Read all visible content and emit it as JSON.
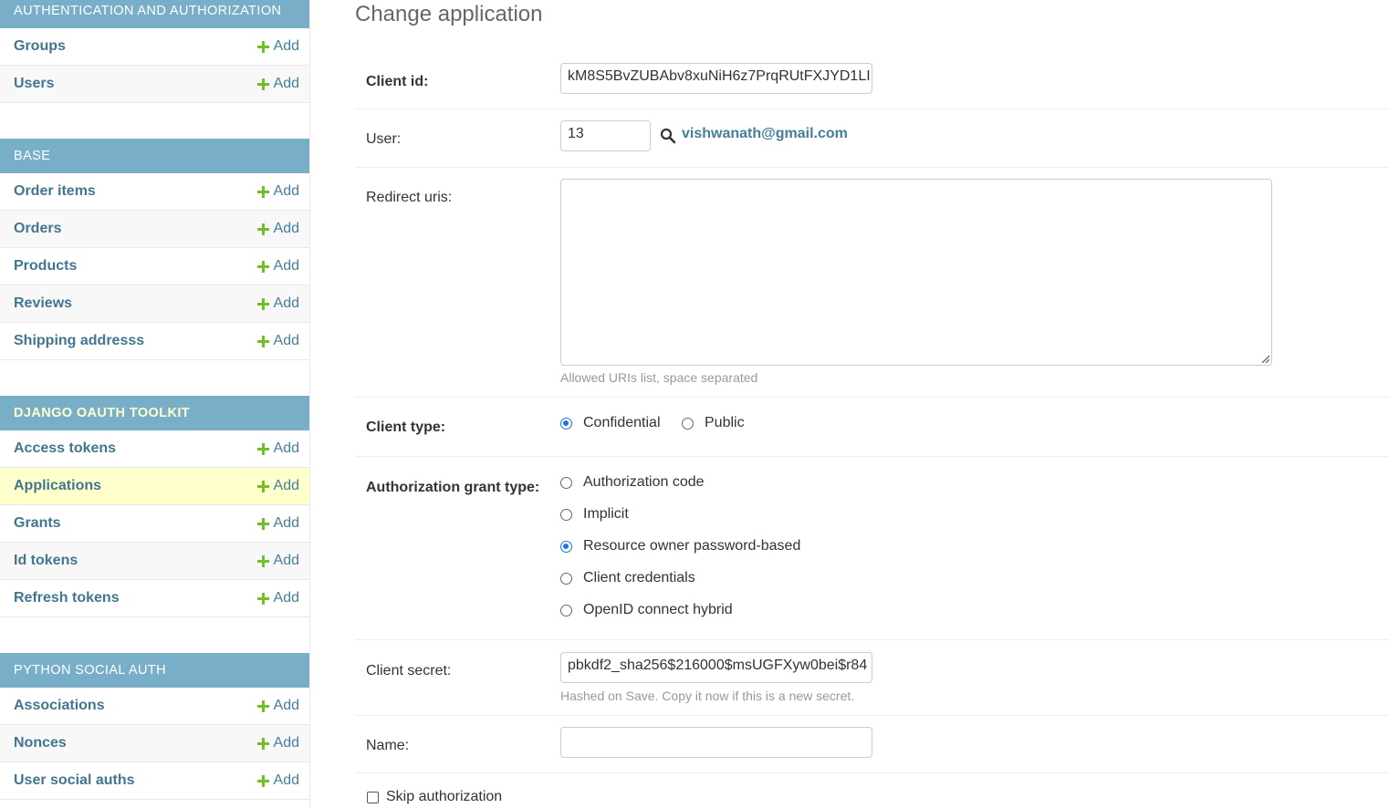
{
  "sidebar": {
    "modules": [
      {
        "caption": "Authentication and Authorization",
        "models": [
          {
            "name": "Groups",
            "add": "Add"
          },
          {
            "name": "Users",
            "add": "Add"
          }
        ]
      },
      {
        "caption": "Base",
        "models": [
          {
            "name": "Order items",
            "add": "Add"
          },
          {
            "name": "Orders",
            "add": "Add"
          },
          {
            "name": "Products",
            "add": "Add"
          },
          {
            "name": "Reviews",
            "add": "Add"
          },
          {
            "name": "Shipping addresss",
            "add": "Add"
          }
        ]
      },
      {
        "caption": "Django OAuth Toolkit",
        "models": [
          {
            "name": "Access tokens",
            "add": "Add"
          },
          {
            "name": "Applications",
            "add": "Add"
          },
          {
            "name": "Grants",
            "add": "Add"
          },
          {
            "name": "Id tokens",
            "add": "Add"
          },
          {
            "name": "Refresh tokens",
            "add": "Add"
          }
        ]
      },
      {
        "caption": "Python Social Auth",
        "models": [
          {
            "name": "Associations",
            "add": "Add"
          },
          {
            "name": "Nonces",
            "add": "Add"
          },
          {
            "name": "User social auths",
            "add": "Add"
          }
        ]
      }
    ]
  },
  "page": {
    "title": "Change application"
  },
  "form": {
    "client_id": {
      "label": "Client id:",
      "value": "kM8S5BvZUBAbv8xuNiH6z7PrqRUtFXJYD1LI"
    },
    "user": {
      "label": "User:",
      "value": "13",
      "link": "vishwanath@gmail.com"
    },
    "redirect_uris": {
      "label": "Redirect uris:",
      "value": "",
      "help": "Allowed URIs list, space separated"
    },
    "client_type": {
      "label": "Client type:",
      "options": [
        "Confidential",
        "Public"
      ],
      "selected": "Confidential"
    },
    "grant_type": {
      "label": "Authorization grant type:",
      "options": [
        "Authorization code",
        "Implicit",
        "Resource owner password-based",
        "Client credentials",
        "OpenID connect hybrid"
      ],
      "selected": "Resource owner password-based"
    },
    "client_secret": {
      "label": "Client secret:",
      "value": "pbkdf2_sha256$216000$msUGFXyw0bei$r84",
      "help": "Hashed on Save. Copy it now if this is a new secret."
    },
    "name": {
      "label": "Name:",
      "value": ""
    },
    "skip_authorization": {
      "label": "Skip authorization",
      "checked": false
    }
  },
  "colors": {
    "module_header": "#79aec8",
    "link": "#417690",
    "add_icon": "#70bf2b",
    "current_row": "#ffffcc",
    "radio_checked": "#1a73e8"
  }
}
